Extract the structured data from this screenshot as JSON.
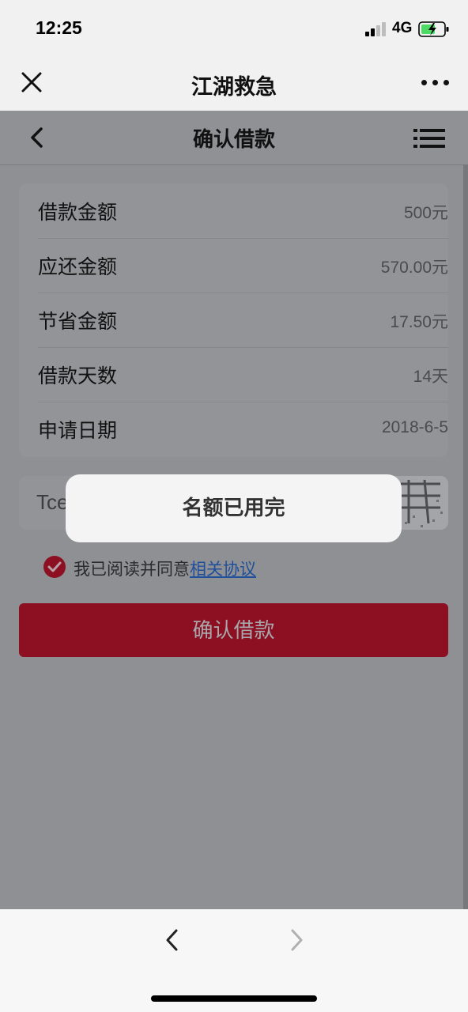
{
  "status_bar": {
    "time": "12:25",
    "network": "4G"
  },
  "wechat_bar": {
    "title": "江湖救急"
  },
  "page": {
    "title": "确认借款",
    "rows": [
      {
        "label": "借款金额",
        "value": "500元"
      },
      {
        "label": "应还金额",
        "value": "570.00元"
      },
      {
        "label": "节省金额",
        "value": "17.50元"
      },
      {
        "label": "借款天数",
        "value": "14天"
      },
      {
        "label": "申请日期",
        "value": "2018-6-5"
      }
    ],
    "captcha": {
      "input_value": "Tcei"
    },
    "agreement": {
      "text": "我已阅读并同意",
      "link": "相关协议"
    },
    "confirm_label": "确认借款"
  },
  "toast": {
    "message": "名额已用完"
  },
  "colors": {
    "accent": "#8c1022",
    "link": "#1f4f9a",
    "overlay": "#8e9094"
  }
}
